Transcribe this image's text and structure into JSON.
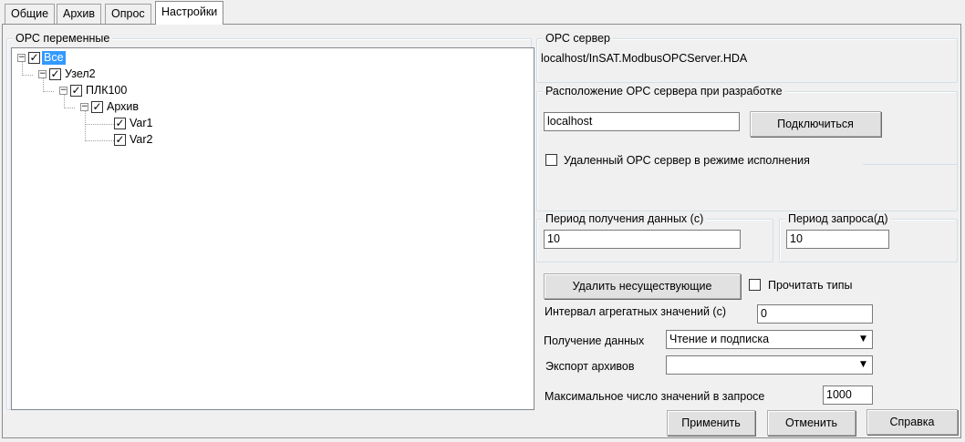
{
  "tabs": [
    {
      "label": "Общие"
    },
    {
      "label": "Архив"
    },
    {
      "label": "Опрос"
    },
    {
      "label": "Настройки"
    }
  ],
  "opc_vars": {
    "title": "ОРС переменные",
    "tree": [
      {
        "label": "Все",
        "checked": true,
        "expanded": true,
        "selected": true
      },
      {
        "label": "Узел2",
        "checked": true,
        "expanded": true
      },
      {
        "label": "ПЛК100",
        "checked": true,
        "expanded": true
      },
      {
        "label": "Архив",
        "checked": true,
        "expanded": true
      },
      {
        "label": "Var1",
        "checked": true
      },
      {
        "label": "Var2",
        "checked": true
      }
    ]
  },
  "opc_server": {
    "title": "ОРС сервер",
    "value": "localhost/InSAT.ModbusOPCServer.HDA"
  },
  "dev_location": {
    "title": "Расположение ОРС сервера при разработке",
    "host_value": "localhost",
    "connect_label": "Подключиться",
    "remote_label": "Удаленный ОРС сервер в режиме исполнения",
    "remote_checked": false
  },
  "period_data": {
    "title": "Период получения данных (с)",
    "value": "10"
  },
  "period_request": {
    "title": "Период запроса(д)",
    "value": "10"
  },
  "options": {
    "delete_label": "Удалить несуществующие",
    "read_types_label": "Прочитать типы",
    "read_types_checked": false,
    "aggregate_label": "Интервал агрегатных значений (с)",
    "aggregate_value": "0",
    "receive_label": "Получение данных",
    "receive_value": "Чтение и подписка",
    "export_label": "Экспорт архивов",
    "export_value": "",
    "max_values_label": "Максимальное число значений в запросе",
    "max_values_value": "1000"
  },
  "footer": {
    "apply_label": "Применить",
    "cancel_label": "Отменить",
    "help_label": "Справка"
  }
}
